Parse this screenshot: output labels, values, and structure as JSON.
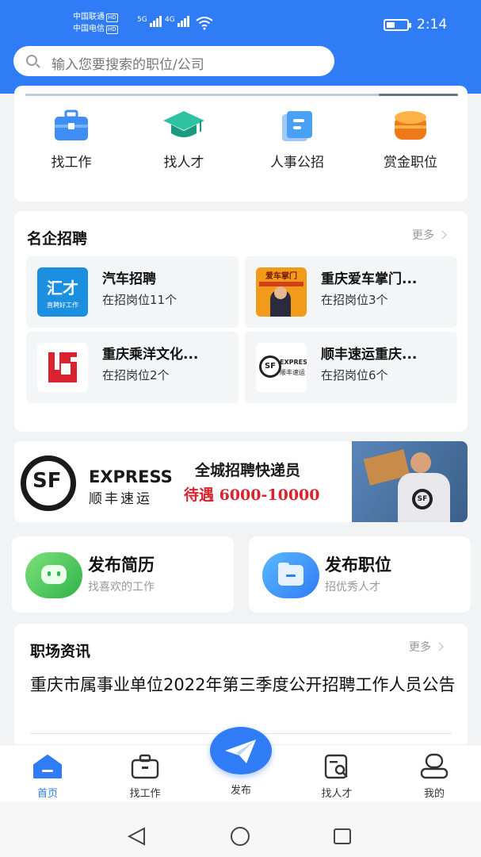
{
  "status_bar": {
    "carrier1": "中国联通",
    "carrier2": "中国电信",
    "hd": "HD",
    "net1": "5G",
    "net2": "4G",
    "time": "2:14"
  },
  "search": {
    "placeholder": "输入您要搜索的职位/公司"
  },
  "quick_actions": [
    {
      "label": "找工作",
      "icon": "briefcase-icon",
      "color": "#3f8df5"
    },
    {
      "label": "找人才",
      "icon": "graduation-cap-icon",
      "color": "#28b59a"
    },
    {
      "label": "人事公招",
      "icon": "document-icon",
      "color": "#4aa0f5"
    },
    {
      "label": "赏金职位",
      "icon": "coin-stack-icon",
      "color": "#f59a2f"
    }
  ],
  "famous_companies": {
    "title": "名企招聘",
    "more": "更多",
    "items": [
      {
        "name": "汽车招聘",
        "count": "在招岗位11个",
        "logo_text": "汇才",
        "logo_sub": "直聘好工作"
      },
      {
        "name": "重庆爱车掌门...",
        "count": "在招岗位3个",
        "logo_text": "爱车掌门"
      },
      {
        "name": "重庆乘洋文化...",
        "count": "在招岗位2个"
      },
      {
        "name": "顺丰速运重庆...",
        "count": "在招岗位6个",
        "logo_text": "EXPRESS",
        "logo_sub": "顺丰速运"
      }
    ]
  },
  "banner": {
    "brand": "EXPRESS",
    "brand_cn": "顺丰速运",
    "headline": "全城招聘快递员",
    "salary": "待遇 6000-10000"
  },
  "publish": {
    "resume": {
      "title": "发布简历",
      "subtitle": "找喜欢的工作"
    },
    "job": {
      "title": "发布职位",
      "subtitle": "招优秀人才"
    }
  },
  "news": {
    "title": "职场资讯",
    "more": "更多",
    "headline": "重庆市属事业单位2022年第三季度公开招聘工作人员公告"
  },
  "tabbar": {
    "home": "首页",
    "find_job": "找工作",
    "publish": "发布",
    "find_talent": "找人才",
    "mine": "我的"
  },
  "colors": {
    "brand": "#2f7cf6",
    "accent_red": "#d9232e",
    "green": "#4cc36a"
  }
}
